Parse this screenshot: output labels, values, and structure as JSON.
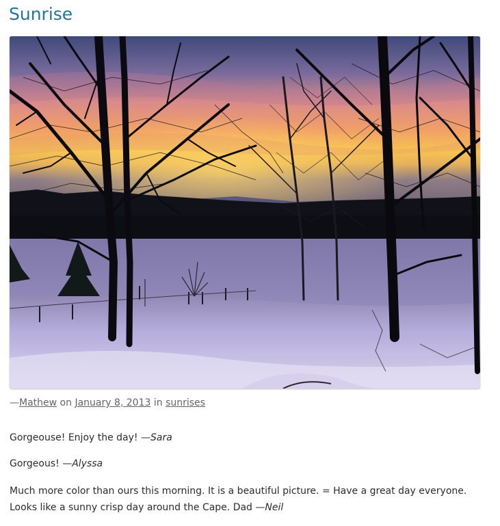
{
  "post": {
    "title": "Sunrise",
    "image_alt": "Sunrise over snowy field with bare trees"
  },
  "meta": {
    "dash": "—",
    "author": "Mathew",
    "on_word": " on ",
    "date": "January 8, 2013",
    "in_word": " in ",
    "category": "sunrises"
  },
  "comments": [
    {
      "text": "Gorgeouse! Enjoy the day! —",
      "author": "Sara"
    },
    {
      "text": "Gorgeous! —",
      "author": "Alyssa"
    },
    {
      "line1": "Much more color than ours this morning. It is a beautiful picture. = Have a great day everyone.",
      "line2": "Looks like a sunny crisp day around the Cape. Dad —",
      "author": "Neil"
    }
  ],
  "colors": {
    "title": "#21759b",
    "meta_text": "#636363",
    "body_text": "#2b2b2b"
  }
}
